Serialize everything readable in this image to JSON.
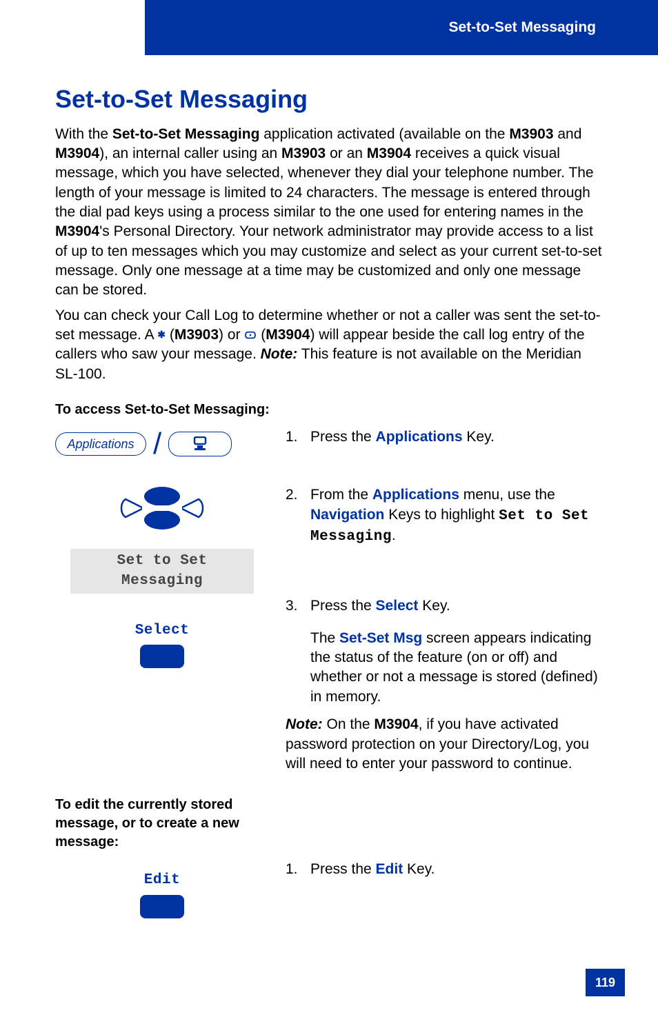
{
  "header": {
    "section_title": "Set-to-Set Messaging"
  },
  "title": "Set-to-Set Messaging",
  "intro": {
    "p1_pre": "With the ",
    "app_name": "Set-to-Set Messaging",
    "p1_mid1": " application activated (available on the ",
    "model1": "M3903",
    "p1_mid2": " and ",
    "model2": "M3904",
    "p1_mid3": "), an internal caller using an ",
    "p1_mid4": " or an ",
    "p1_mid5": " receives a quick visual message, which you have selected, whenever they dial your telephone number. The length of your message is limited to 24 characters. The message is entered through the dial pad keys using a process similar to the one used for entering names in the ",
    "p1_tail": "'s Personal Directory. Your network administrator may provide access to a list of up to ten messages which you may customize and select as your current set-to-set message. Only one message at a time may be customized and only one message can be stored."
  },
  "intro2": {
    "p2_pre": "You can check your Call Log to determine whether or not a caller was sent the set-to-set message. A ",
    "p2_mid1": " (",
    "p2_model1": "M3903",
    "p2_mid2": ") or ",
    "p2_mid3": " (",
    "p2_model2": "M3904",
    "p2_tail": ") will appear beside the call log entry of the callers who saw your message. ",
    "note_lbl": "Note:",
    "p2_note": " This feature is not available on the Meridian SL-100."
  },
  "subhead1": "To access Set-to-Set Messaging:",
  "left": {
    "app_key_label": "Applications",
    "menu_item": "Set to Set Messaging",
    "softkey_select": "Select",
    "softkey_edit": "Edit"
  },
  "steps_a": {
    "s1_num": "1.",
    "s1_pre": "Press the ",
    "s1_key": "Applications",
    "s1_post": " Key.",
    "s2_num": "2.",
    "s2_pre": "From the ",
    "s2_key1": "Applications",
    "s2_mid": " menu, use the ",
    "s2_key2": "Navigation",
    "s2_mid2": " Keys to highlight ",
    "s2_lcd": "Set to Set Messaging",
    "s2_post": ".",
    "s3_num": "3.",
    "s3_pre": "Press the ",
    "s3_key": "Select",
    "s3_post": " Key.",
    "s3_sub_pre": "The ",
    "s3_sub_key": "Set-Set Msg",
    "s3_sub_post": " screen appears indicating the status of the feature (on or off) and whether or not a message is stored (defined) in memory.",
    "note_lbl": "Note:",
    "note_pre": " On the ",
    "note_model": "M3904",
    "note_post": ", if you have activated password protection on your Directory/Log, you will need to enter your password to continue."
  },
  "subhead2": "To edit the currently stored message, or to create a new message:",
  "steps_b": {
    "s1_num": "1.",
    "s1_pre": "Press the ",
    "s1_key": "Edit",
    "s1_post": " Key."
  },
  "page_number": "119"
}
